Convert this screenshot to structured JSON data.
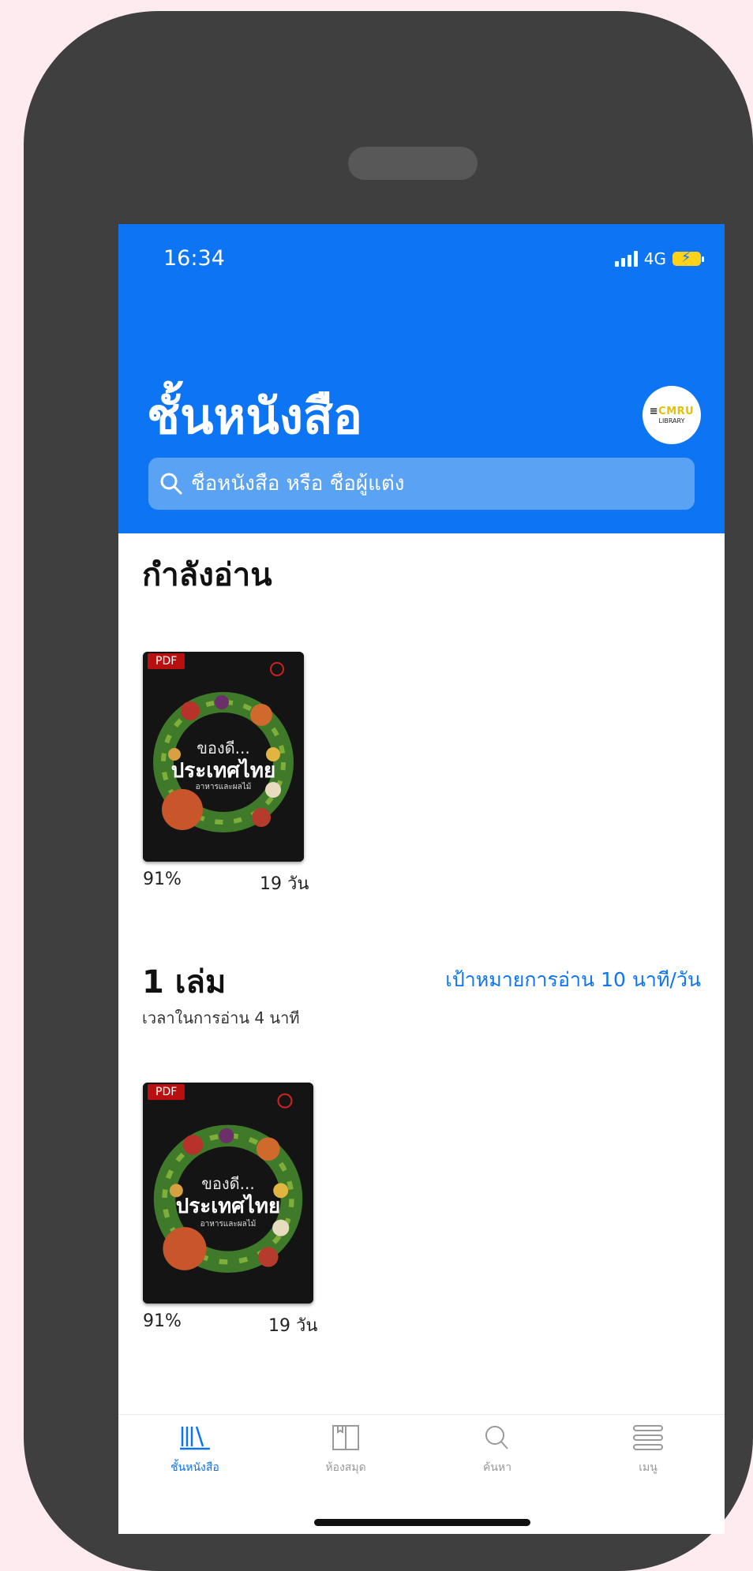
{
  "status_bar": {
    "time": "16:34",
    "network": "4G"
  },
  "header": {
    "title": "ชั้นหนังสือ",
    "avatar_line1_a": "CMRU",
    "avatar_line2": "LIBRARY"
  },
  "search": {
    "placeholder": "ชื่อหนังสือ หรือ ชื่อผู้แต่ง"
  },
  "reading": {
    "section_title": "กำลังอ่าน",
    "book": {
      "badge": "PDF",
      "cover_line1": "ของดี...",
      "cover_line2": "ประเทศไทย",
      "cover_line3": "อาหารและผลไม้",
      "progress": "91%",
      "days": "19 วัน"
    }
  },
  "goal": {
    "count_title": "1 เล่ม",
    "goal_link": "เป้าหมายการอ่าน 10 นาที/วัน",
    "reading_time": "เวลาในการอ่าน 4 นาที",
    "book": {
      "badge": "PDF",
      "cover_line1": "ของดี...",
      "cover_line2": "ประเทศไทย",
      "cover_line3": "อาหารและผลไม้",
      "progress": "91%",
      "days": "19 วัน"
    }
  },
  "tabs": [
    {
      "label": "ชั้นหนังสือ",
      "icon": "bookshelf-icon",
      "active": true
    },
    {
      "label": "ห้องสมุด",
      "icon": "library-icon",
      "active": false
    },
    {
      "label": "ค้นหา",
      "icon": "search-icon",
      "active": false
    },
    {
      "label": "เมนู",
      "icon": "menu-icon",
      "active": false
    }
  ],
  "colors": {
    "accent": "#0d74f3",
    "pdf_badge": "#b80f0f"
  }
}
